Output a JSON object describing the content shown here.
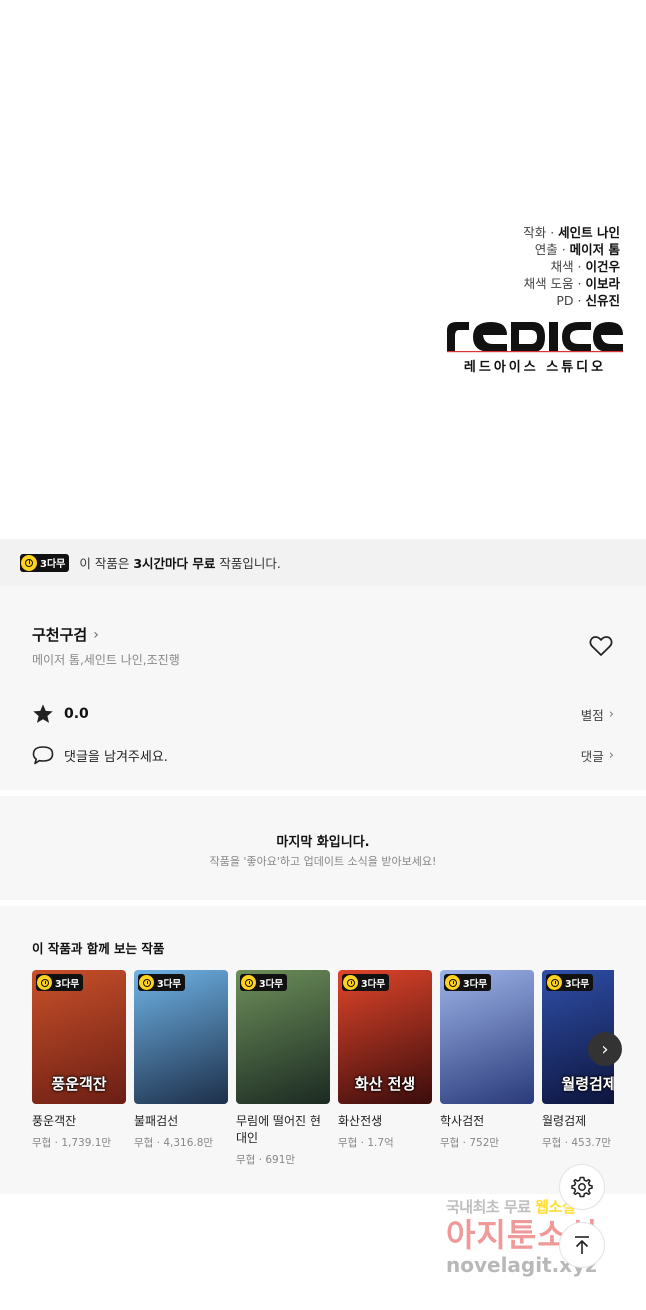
{
  "credits": [
    {
      "role": "작화 · ",
      "name": "세인트 나인"
    },
    {
      "role": "연출 · ",
      "name": "메이저 톰"
    },
    {
      "role": "채색 · ",
      "name": "이건우"
    },
    {
      "role": "채색 도움 · ",
      "name": "이보라"
    },
    {
      "role": "PD · ",
      "name": "신유진"
    }
  ],
  "studio": {
    "logo_text": "REDICE",
    "subtitle": "레드아이스 스튜디오"
  },
  "free_banner": {
    "badge": "3다무",
    "pre": "이 작품은 ",
    "bold": "3시간마다 무료",
    "post": " 작품입니다."
  },
  "work": {
    "title": "구천구검",
    "authors": "메이저 톰,세인트 나인,조진행",
    "rating": "0.0",
    "rating_link": "별점",
    "comment_prompt": "댓글을 남겨주세요.",
    "comment_link": "댓글"
  },
  "last_episode": {
    "title": "마지막 화입니다.",
    "subtitle": "작품을 '좋아요'하고 업데이트 소식을 받아보세요!"
  },
  "recommendations": {
    "heading": "이 작품과 함께 보는 작품",
    "items": [
      {
        "badge": "3다무",
        "cover_text": "풍운객잔",
        "title": "풍운객잔",
        "meta": "무협 · 1,739.1만",
        "colors": [
          "#c8502a",
          "#6b1e14"
        ]
      },
      {
        "badge": "3다무",
        "cover_text": "",
        "title": "불패검선",
        "meta": "무협 · 4,316.8만",
        "colors": [
          "#6fb3e6",
          "#1d2f4a"
        ]
      },
      {
        "badge": "3다무",
        "cover_text": "",
        "title": "무림에 떨어진 현대인",
        "meta": "무협 · 691만",
        "colors": [
          "#6d8f5a",
          "#1b2a22"
        ]
      },
      {
        "badge": "3다무",
        "cover_text": "화산 전생",
        "title": "화산전생",
        "meta": "무협 · 1.7억",
        "colors": [
          "#e0452a",
          "#3a0c0c"
        ]
      },
      {
        "badge": "3다무",
        "cover_text": "",
        "title": "학사검전",
        "meta": "무협 · 752만",
        "colors": [
          "#9db3e8",
          "#2a3a7a"
        ]
      },
      {
        "badge": "3다무",
        "cover_text": "월령검제",
        "title": "월령검제",
        "meta": "무협 · 453.7만",
        "colors": [
          "#2f4fa8",
          "#0c1238"
        ]
      }
    ]
  },
  "watermark": {
    "line1_a": "국내최초 무료 ",
    "line1_b": "웹소설",
    "line2": "아지툰소설",
    "line3": "novelagit.xyz"
  },
  "icons": {
    "heart": "heart-icon",
    "star": "star-icon",
    "comment": "comment-icon",
    "settings": "gear-icon",
    "top": "arrow-up-icon",
    "next": "chevron-right-icon"
  }
}
